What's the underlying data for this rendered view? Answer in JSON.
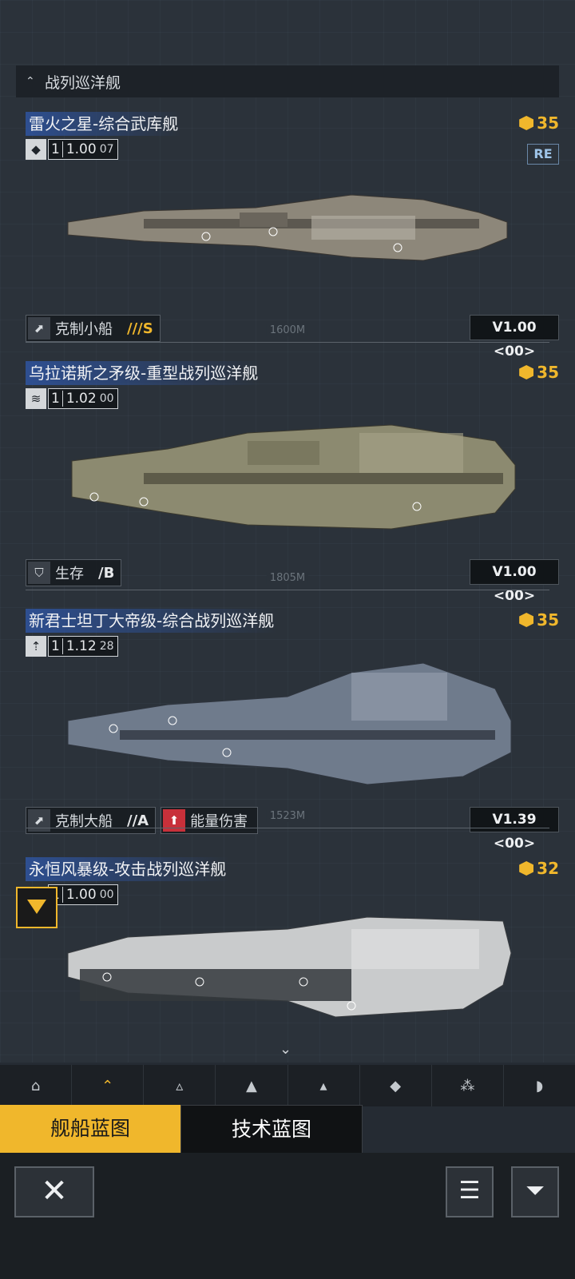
{
  "header": {
    "title": "战列巡洋舰",
    "icon": "chevron-up-icon"
  },
  "ships": [
    {
      "name": "雷火之星-综合武库舰",
      "cost": "35",
      "v1": "1",
      "v2": "1.00",
      "v3": "07",
      "re": "RE",
      "tags": [
        {
          "label": "克制小船",
          "grade": "///S",
          "icon": "anti-small-icon"
        }
      ],
      "distance": "1600M",
      "version": "V1.00 <00>"
    },
    {
      "name": "乌拉诺斯之矛级-重型战列巡洋舰",
      "cost": "35",
      "v1": "1",
      "v2": "1.02",
      "v3": "00",
      "tags": [
        {
          "label": "生存",
          "grade": "/B",
          "icon": "shield-icon"
        }
      ],
      "distance": "1805M",
      "version": "V1.00 <00>"
    },
    {
      "name": "新君士坦丁大帝级-综合战列巡洋舰",
      "cost": "35",
      "v1": "1",
      "v2": "1.12",
      "v3": "28",
      "tags": [
        {
          "label": "克制大船",
          "grade": "//A",
          "icon": "anti-large-icon"
        },
        {
          "label": "能量伤害",
          "grade": "",
          "icon": "energy-icon"
        }
      ],
      "distance": "1523M",
      "version": "V1.39 <00>"
    },
    {
      "name": "永恒风暴级-攻击战列巡洋舰",
      "cost": "32",
      "v1": "1",
      "v2": "1.00",
      "v3": "00"
    }
  ],
  "scroll_hint": "⌄",
  "filter_tabs": [
    "all-icon",
    "battlecruiser-icon",
    "frigate-icon",
    "destroyer-icon",
    "cruiser-icon",
    "carrier-icon",
    "auxiliary-icon",
    "station-icon"
  ],
  "blueprint_tabs": {
    "ship": "舰船蓝图",
    "tech": "技术蓝图"
  },
  "buttons": {
    "close": "close-icon",
    "list": "list-icon",
    "filter": "filter-icon"
  }
}
